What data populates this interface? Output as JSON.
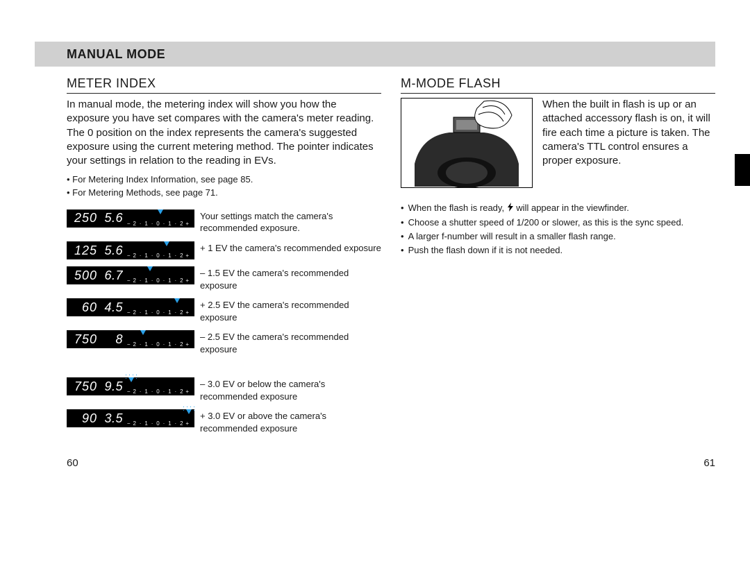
{
  "header": {
    "title": "MANUAL MODE"
  },
  "left": {
    "title": "METER INDEX",
    "para": "In manual mode, the metering index will show you how the exposure you have set compares with the camera's meter reading. The 0 position on the index represents the camera's suggested exposure using the current metering method. The pointer indicates your settings in relation to the reading in EVs.",
    "bullets": [
      "For Metering Index Information, see page 85.",
      "For Metering Methods, see page 71."
    ],
    "scale_ticks": [
      "−",
      "2",
      "·",
      "1",
      "·",
      "0",
      "·",
      "1",
      "·",
      "2",
      "+"
    ],
    "rows": [
      {
        "shutter": "250",
        "aperture": "5.6",
        "pointer_pct": 50,
        "blink": false,
        "desc": "Your settings match the camera's recommended exposure."
      },
      {
        "shutter": "125",
        "aperture": "5.6",
        "pointer_pct": 60,
        "blink": false,
        "desc": "+ 1 EV the camera's recommended exposure"
      },
      {
        "shutter": "500",
        "aperture": "6.7",
        "pointer_pct": 35,
        "blink": false,
        "desc": "– 1.5 EV the camera's recommended exposure"
      },
      {
        "shutter": "60",
        "aperture": "4.5",
        "pointer_pct": 75,
        "blink": false,
        "desc": "+ 2.5 EV the camera's recommended exposure"
      },
      {
        "shutter": "750",
        "aperture": "8",
        "pointer_pct": 25,
        "blink": false,
        "desc": "– 2.5 EV the camera's recommended exposure"
      },
      {
        "shutter": "750",
        "aperture": "9.5",
        "pointer_pct": 8,
        "blink": true,
        "desc": "– 3.0 EV or below the camera's recommended exposure"
      },
      {
        "shutter": "90",
        "aperture": "3.5",
        "pointer_pct": 92,
        "blink": true,
        "desc": "+ 3.0 EV or above the camera's recommended exposure"
      }
    ]
  },
  "right": {
    "title": "M-MODE FLASH",
    "para": "When the built in flash is up or an attached accessory flash is on, it will fire each time a picture is taken. The camera's TTL control ensures a proper exposure.",
    "flash_ready_pre": "When the flash is ready, ",
    "flash_ready_post": " will appear in the viewfinder.",
    "bullets_rest": [
      "Choose a shutter speed of 1/200 or slower, as this is the sync speed.",
      "A larger f-number will result in a smaller flash range.",
      "Push the flash down if it is not needed."
    ]
  },
  "page": {
    "left": "60",
    "right": "61"
  }
}
